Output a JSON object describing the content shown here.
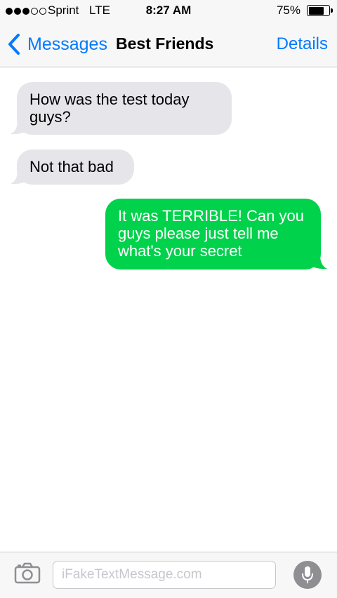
{
  "status_bar": {
    "signal_bars_filled": 3,
    "signal_bars_total": 5,
    "carrier": "Sprint",
    "network": "LTE",
    "time": "8:27 AM",
    "battery_percent": "75%",
    "battery_level": 0.75
  },
  "nav": {
    "back_label": "Messages",
    "title": "Best Friends",
    "details_label": "Details"
  },
  "messages": [
    {
      "direction": "incoming",
      "text": "How was the test today guys?"
    },
    {
      "direction": "incoming",
      "text": "Not that bad"
    },
    {
      "direction": "outgoing",
      "text": "It was TERRIBLE! Can you guys please just tell me what's your secret"
    }
  ],
  "input": {
    "placeholder": "iFakeTextMessage.com",
    "value": ""
  },
  "icons": {
    "back": "chevron-left-icon",
    "camera": "camera-icon",
    "mic": "microphone-icon"
  },
  "colors": {
    "accent": "#007aff",
    "incoming_bubble": "#e5e5ea",
    "outgoing_bubble": "#00d24b",
    "bar_background": "#f7f7f7",
    "mic_background": "#8e8e93"
  }
}
